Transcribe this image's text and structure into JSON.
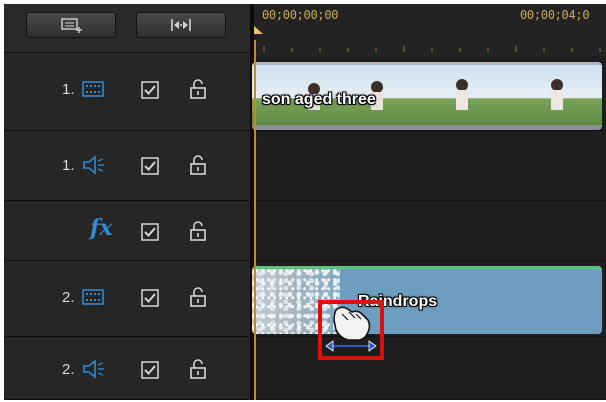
{
  "toolbar": {
    "buttons": [
      {
        "name": "add-track-icon"
      },
      {
        "name": "fit-timeline-icon"
      }
    ]
  },
  "ruler": {
    "timecode_start": "00;00;00;00",
    "timecode_next": "00;00;04;0"
  },
  "tracks": [
    {
      "number": "1.",
      "type": "video",
      "icon": "video-track-icon"
    },
    {
      "number": "1.",
      "type": "audio",
      "icon": "audio-track-icon"
    },
    {
      "number": "",
      "type": "effect",
      "icon": "fx-icon",
      "fx_label": "fx"
    },
    {
      "number": "2.",
      "type": "video",
      "icon": "video-track-icon"
    },
    {
      "number": "2.",
      "type": "audio",
      "icon": "audio-track-icon"
    }
  ],
  "clips": {
    "video1": {
      "label": "son aged three"
    },
    "video2": {
      "label": "Raindrops"
    }
  },
  "colors": {
    "accent": "#2e8bd6",
    "timecode": "#c9a85a",
    "highlight": "#e10e0e"
  }
}
